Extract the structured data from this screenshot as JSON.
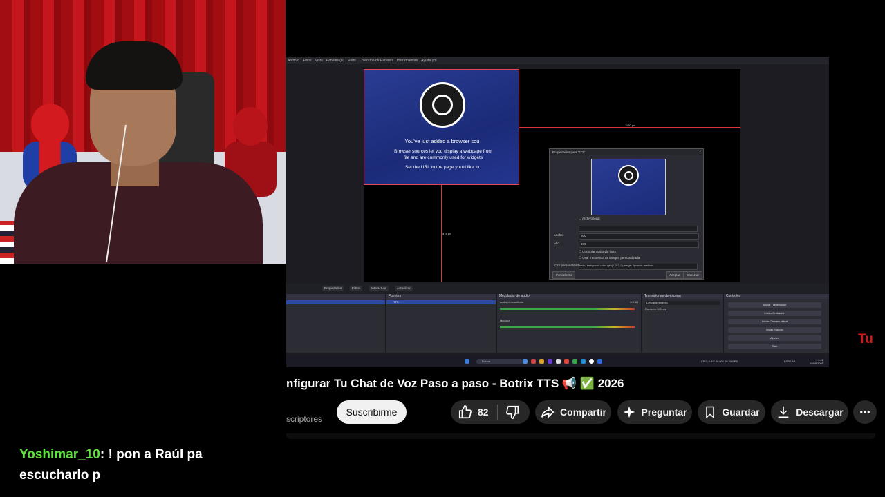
{
  "chat": {
    "username": "Yoshimar_10",
    "message_line1": ": ! pon a Raúl pa",
    "message_line2": "escucharlo p"
  },
  "obs": {
    "menu": [
      "Archivo",
      "Editar",
      "Vista",
      "Paneles (D)",
      "Perfil",
      "Colección de Escenas",
      "Herramientas",
      "Ayuda (H)"
    ],
    "browser_source": {
      "line1": "You've just added a browser sou",
      "line2a": "Browser sources let you display a webpage from",
      "line2b": "file and are commonly used for widgets",
      "line3": "Set the URL to the page you'd like to"
    },
    "dim_width": "1120 px",
    "dim_height": "478 px",
    "props_dialog": {
      "title": "Propiedades para 'TTS'",
      "local_file": "Archivo local",
      "width_label": "Ancho",
      "width_value": "800",
      "height_label": "Alto",
      "height_value": "600",
      "audio_check": "Controlar audio vía OBS",
      "fps_check": "Usar frecuencia de imagen personalizada",
      "css_label": "CSS personalizado",
      "css_value": "body { background-color: rgba(0, 0, 0, 0); margin: 0px auto; overflow:",
      "defaults_btn": "Por defecto",
      "accept_btn": "Aceptar",
      "cancel_btn": "Cancelar"
    },
    "toolbar": [
      "Propiedades",
      "Filtros",
      "Interactuar",
      "Actualizar"
    ],
    "docks": {
      "sources_title": "Fuentes",
      "source_item": "TTS",
      "mixer_title": "Mezclador de audio",
      "mixer_ch1": "Audio del escritorio",
      "mixer_ch2": "Mic/Aux",
      "mixer_db": "0.0 dB",
      "transitions_title": "Transiciones de escena",
      "transition_value": "Desvanecimiento",
      "duration_label": "Duración",
      "duration_value": "300 ms",
      "controls_title": "Controles",
      "controls": [
        "Iniciar Transmisión",
        "Iniciar Grabación",
        "Iniciar Cámara virtual",
        "Modo Estudio",
        "Ajustes",
        "Salir"
      ]
    },
    "taskbar": {
      "search": "Buscar",
      "status": "CPU: 0.8%   30.00 / 30.00 FPS",
      "lang": "ESP LAA",
      "time": "9:46",
      "date": "16/09/2025"
    }
  },
  "channel_logo": "Tu",
  "video": {
    "title": "nfigurar Tu Chat de Voz Paso a paso - Botrix TTS 📢 ✅ 2026",
    "subs_text": "scriptores",
    "subscribe_label": "Suscribirme",
    "like_count": "82",
    "share_label": "Compartir",
    "ask_label": "Preguntar",
    "save_label": "Guardar",
    "download_label": "Descargar"
  }
}
